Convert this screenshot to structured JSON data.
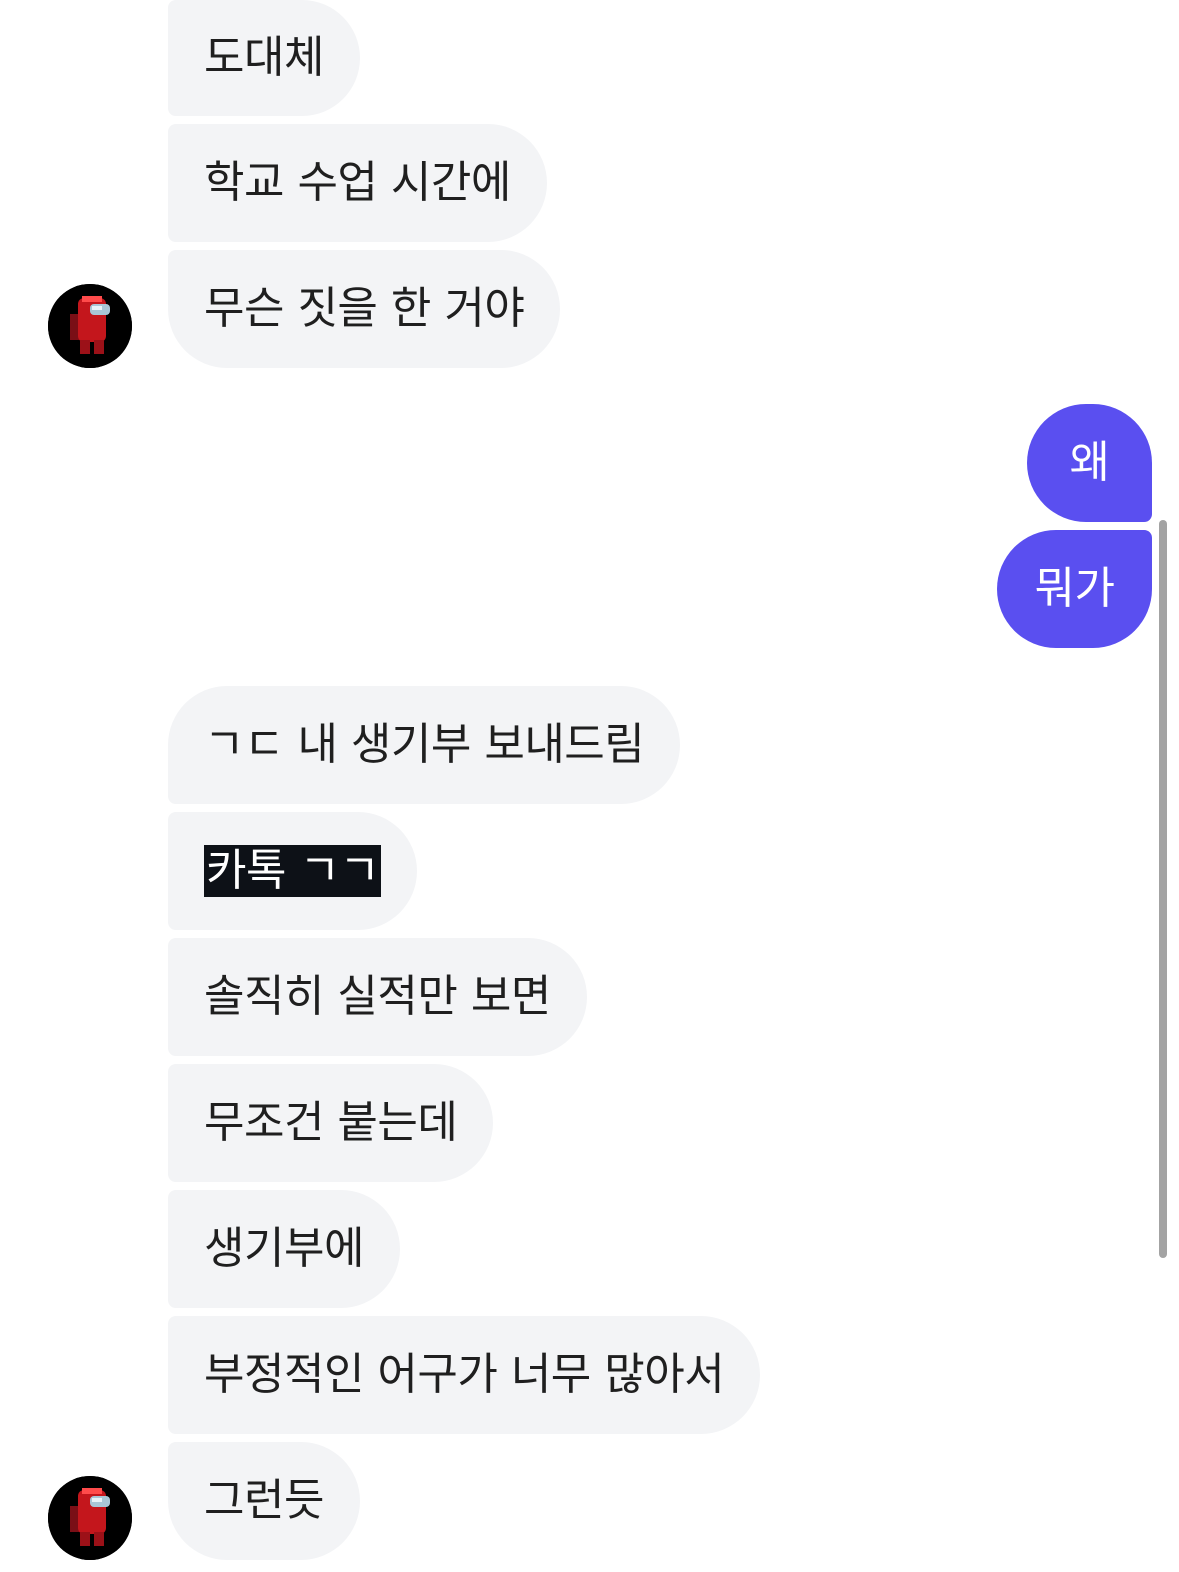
{
  "colors": {
    "received_bubble": "#f3f4f6",
    "sent_bubble": "#5a4ff0",
    "highlight": "#0d1117"
  },
  "messages": [
    {
      "from": "them",
      "text": "도대체"
    },
    {
      "from": "them",
      "text": "학교 수업 시간에"
    },
    {
      "from": "them",
      "text": "무슨 짓을 한 거야"
    },
    {
      "from": "me",
      "text": "왜"
    },
    {
      "from": "me",
      "text": "뭐가"
    },
    {
      "from": "them",
      "text": "ㄱㄷ 내 생기부 보내드림"
    },
    {
      "from": "them",
      "text": "카톡 ㄱㄱ",
      "highlighted": true
    },
    {
      "from": "them",
      "text": "솔직히 실적만 보면"
    },
    {
      "from": "them",
      "text": "무조건 붙는데"
    },
    {
      "from": "them",
      "text": "생기부에"
    },
    {
      "from": "them",
      "text": "부정적인 어구가 너무 많아서"
    },
    {
      "from": "them",
      "text": "그런듯"
    }
  ],
  "avatar_icon": "among-us-crewmate-icon"
}
